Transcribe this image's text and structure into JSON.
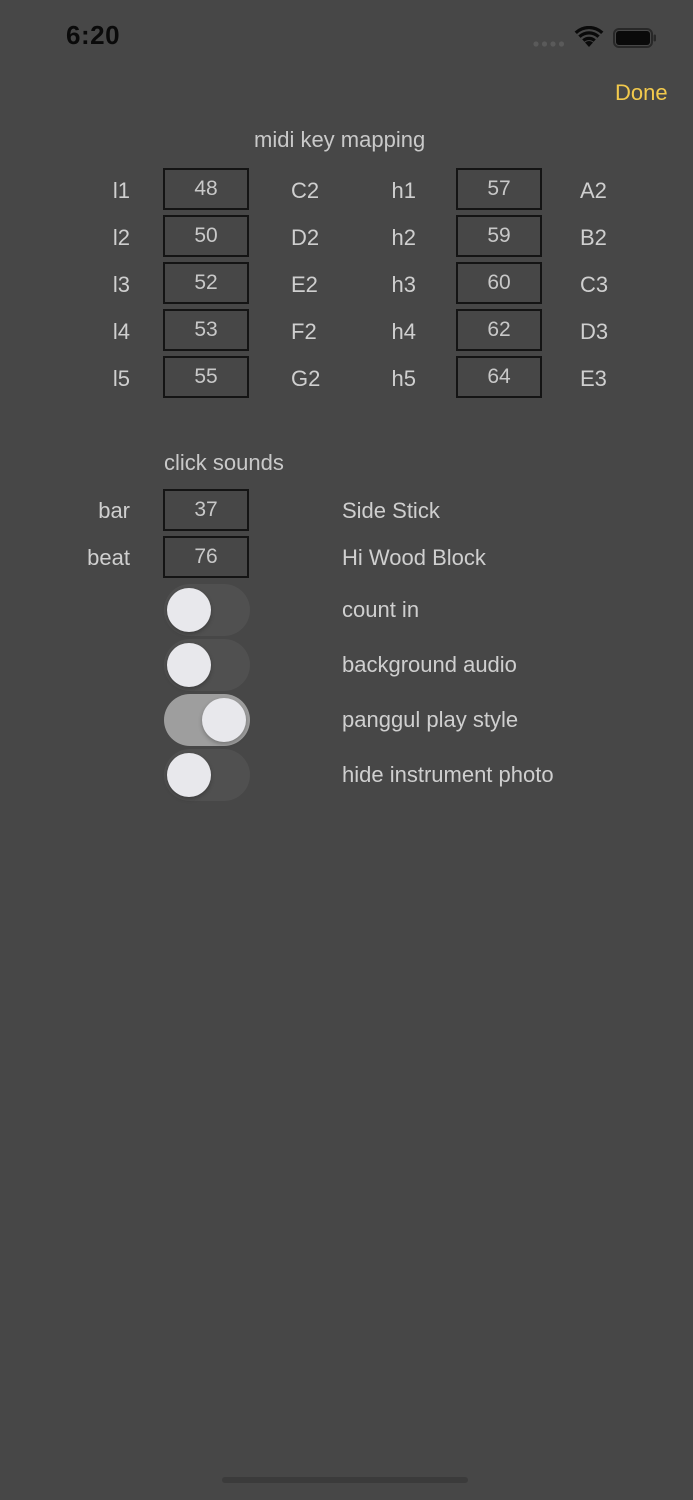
{
  "status_bar": {
    "time": "6:20"
  },
  "nav": {
    "done_label": "Done",
    "accent_color": "#f2c94c"
  },
  "midi_mapping": {
    "title": "midi key mapping",
    "low": [
      {
        "label": "l1",
        "value": "48",
        "note": "C2"
      },
      {
        "label": "l2",
        "value": "50",
        "note": "D2"
      },
      {
        "label": "l3",
        "value": "52",
        "note": "E2"
      },
      {
        "label": "l4",
        "value": "53",
        "note": "F2"
      },
      {
        "label": "l5",
        "value": "55",
        "note": "G2"
      }
    ],
    "high": [
      {
        "label": "h1",
        "value": "57",
        "note": "A2"
      },
      {
        "label": "h2",
        "value": "59",
        "note": "B2"
      },
      {
        "label": "h3",
        "value": "60",
        "note": "C3"
      },
      {
        "label": "h4",
        "value": "62",
        "note": "D3"
      },
      {
        "label": "h5",
        "value": "64",
        "note": "E3"
      }
    ]
  },
  "click_sounds": {
    "title": "click sounds",
    "rows": [
      {
        "label": "bar",
        "value": "37",
        "sound": "Side Stick"
      },
      {
        "label": "beat",
        "value": "76",
        "sound": "Hi Wood Block"
      }
    ]
  },
  "toggles": [
    {
      "label": "count in",
      "on": false
    },
    {
      "label": "background audio",
      "on": false
    },
    {
      "label": "panggul play style",
      "on": true
    },
    {
      "label": "hide instrument photo",
      "on": false
    }
  ]
}
